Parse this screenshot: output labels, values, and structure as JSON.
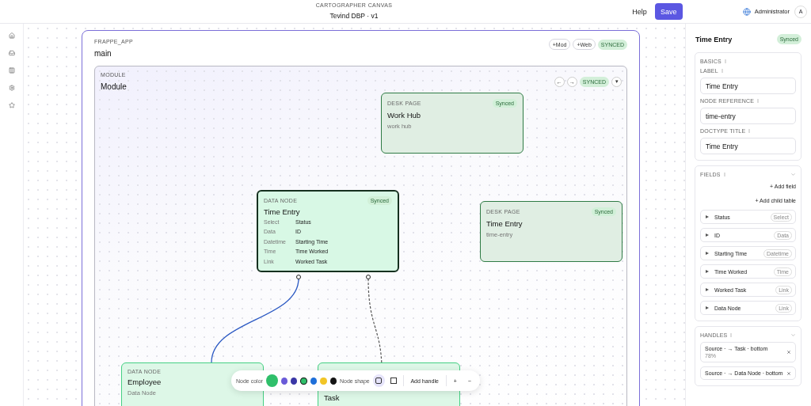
{
  "header": {
    "subtitle": "CARTOGRAPHER CANVAS",
    "title": "Tevind DBP · v1",
    "help": "Help",
    "save": "Save",
    "user": "Administrator",
    "avatar": "A"
  },
  "app": {
    "type_label": "FRAPPE_APP",
    "name": "main",
    "actions": [
      "+Mod",
      "+Web"
    ],
    "status": "SYNCED"
  },
  "module": {
    "type_label": "MODULE",
    "name": "Module",
    "nav": [
      "←",
      "→"
    ],
    "status": "SYNCED",
    "menu": "▾"
  },
  "nodes": [
    {
      "kind": "desk",
      "type_label": "DESK PAGE",
      "title": "Work Hub",
      "subtitle": "work hub",
      "status": "Synced",
      "selected": false
    },
    {
      "kind": "data",
      "type_label": "DATA NODE",
      "title": "Time Entry",
      "status": "Synced",
      "selected": true,
      "fields": [
        {
          "type": "Select",
          "name": "Status"
        },
        {
          "type": "Data",
          "name": "ID"
        },
        {
          "type": "Datetime",
          "name": "Starting Time"
        },
        {
          "type": "Time",
          "name": "Time Worked"
        },
        {
          "type": "Link",
          "name": "Worked Task"
        }
      ]
    },
    {
      "kind": "desk",
      "type_label": "DESK PAGE",
      "title": "Time Entry",
      "subtitle": "time-entry",
      "status": "Synced",
      "selected": false
    },
    {
      "kind": "data",
      "type_label": "DATA NODE",
      "title": "Employee",
      "subtitle": "Data Node",
      "selected": false
    },
    {
      "kind": "data",
      "title": "Task",
      "selected": false
    }
  ],
  "toolbar": {
    "color_label": "Node color",
    "colors": [
      {
        "color": "#6a5bd8",
        "selected": false
      },
      {
        "color": "#3a37a6",
        "selected": false
      },
      {
        "color": "#2fbf6a",
        "selected": true
      },
      {
        "color": "#1e6fd9",
        "selected": false
      },
      {
        "color": "#f2c526",
        "selected": false
      },
      {
        "color": "#141414",
        "selected": false
      }
    ],
    "shape_label": "Node shape",
    "shapes": [
      {
        "kind": "rounded",
        "selected": true
      },
      {
        "kind": "square",
        "selected": false
      }
    ],
    "add_handle": "Add handle",
    "zoom_in": "+",
    "zoom_out": "−"
  },
  "panel": {
    "title": "Time Entry",
    "status": "Synced",
    "basics": {
      "title": "BASICS",
      "fields": [
        {
          "label": "LABEL",
          "value": "Time Entry"
        },
        {
          "label": "NODE REFERENCE",
          "value": "time-entry"
        },
        {
          "label": "DOCTYPE TITLE",
          "value": "Time Entry"
        }
      ]
    },
    "fields": {
      "title": "FIELDS",
      "expanded": true,
      "add_field": "+ Add field",
      "add_child": "+ Add child table",
      "items": [
        {
          "name": "Status",
          "type": "Select"
        },
        {
          "name": "ID",
          "type": "Data"
        },
        {
          "name": "Starting Time",
          "type": "Datetime"
        },
        {
          "name": "Time Worked",
          "type": "Time"
        },
        {
          "name": "Worked Task",
          "type": "Link"
        },
        {
          "name": "Data Node",
          "type": "Link"
        }
      ]
    },
    "handles": {
      "title": "HANDLES",
      "expanded": true,
      "items": [
        {
          "text": "Source · → Task · bottom",
          "detail": "78%"
        },
        {
          "text": "Source · → Data Node · bottom"
        }
      ]
    }
  }
}
